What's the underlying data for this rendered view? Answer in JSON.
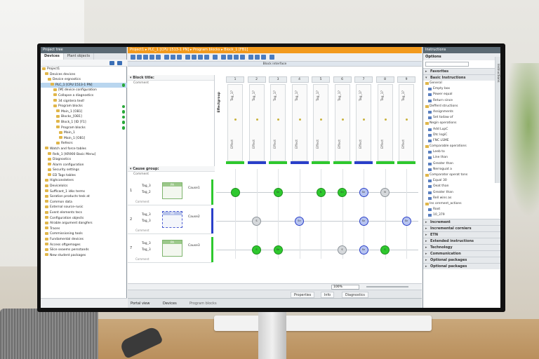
{
  "project_tree": {
    "header": "Project tree",
    "tabs": [
      "Devices",
      "Plant objects"
    ],
    "items": [
      {
        "label": "Project1",
        "ok": false,
        "sel": false
      },
      {
        "label": "Devices devices",
        "ok": false,
        "sel": false
      },
      {
        "label": "Device ergnostics",
        "ok": false,
        "sel": false
      },
      {
        "label": "PLC_1 [CPU 1513-1 PN]",
        "ok": true,
        "sel": true
      },
      {
        "label": "[M] device configuration",
        "ok": false,
        "sel": false
      },
      {
        "label": "Collapse a diagnostics",
        "ok": false,
        "sel": false
      },
      {
        "label": "34 signtera text!",
        "ok": false,
        "sel": false
      },
      {
        "label": "Program blocks",
        "ok": true,
        "sel": false
      },
      {
        "label": "Main_1 [OB1]",
        "ok": true,
        "sel": false
      },
      {
        "label": "Blocks_[OB1]",
        "ok": true,
        "sel": false
      },
      {
        "label": "Block_1 [ID [F1]",
        "ok": true,
        "sel": false
      },
      {
        "label": "Program blocks",
        "ok": true,
        "sel": false
      },
      {
        "label": "Main_1",
        "ok": false,
        "sel": false
      },
      {
        "label": "Main_1 [OB1]",
        "ok": false,
        "sel": false
      },
      {
        "label": "Refesrs",
        "ok": false,
        "sel": false
      },
      {
        "label": "Watch and force tables",
        "ok": false,
        "sel": false
      },
      {
        "label": "Relk_1 [KR900 Basic Menu]",
        "ok": false,
        "sel": false
      },
      {
        "label": "Diagnostics",
        "ok": false,
        "sel": false
      },
      {
        "label": "Alarm configuration",
        "ok": false,
        "sel": false
      },
      {
        "label": "Security settings",
        "ok": false,
        "sel": false
      },
      {
        "label": "ED Tags tables",
        "ok": false,
        "sel": false
      },
      {
        "label": "Highconsteters",
        "ok": false,
        "sel": false
      },
      {
        "label": "Devicelolcs",
        "ok": false,
        "sel": false
      },
      {
        "label": "Sufficant_1 idks terms",
        "ok": false,
        "sel": false
      },
      {
        "label": "Soration products tesk at",
        "ok": false,
        "sel": false
      },
      {
        "label": "Common data",
        "ok": false,
        "sel": false
      },
      {
        "label": "External source-rusic",
        "ok": false,
        "sel": false
      },
      {
        "label": "Event elements tecs",
        "ok": false,
        "sel": false
      },
      {
        "label": "Configuration objects",
        "ok": false,
        "sel": false
      },
      {
        "label": "Alrable argument dangfers",
        "ok": false,
        "sel": false
      },
      {
        "label": "Traces",
        "ok": false,
        "sel": false
      },
      {
        "label": "Commissioning tools",
        "ok": false,
        "sel": false
      },
      {
        "label": "Fundamental devices",
        "ok": false,
        "sel": false
      },
      {
        "label": "Access oftgemages",
        "ok": false,
        "sel": false
      },
      {
        "label": "Slice seaems persstands",
        "ok": false,
        "sel": false
      },
      {
        "label": "New student packages",
        "ok": false,
        "sel": false
      }
    ]
  },
  "editor": {
    "breadcrumb": "Project1 ▸ PLC_1 [CPU 1513-1 PN] ▸ Program blocks ▸ Block_1 [FB1]",
    "interface_header": "Block interface",
    "block_title": "Block title:",
    "block_comment": "Comment",
    "columns": [
      {
        "num": "1",
        "top": "Tag_1?",
        "bottom": "Effect",
        "bar": "#2ec82e"
      },
      {
        "num": "2",
        "top": "Tag_1?",
        "bottom": "Effect",
        "bar": "#2a3fc9"
      },
      {
        "num": "3",
        "top": "Tag_1?",
        "bottom": "Effect",
        "bar": "#2ec82e"
      },
      {
        "num": "4",
        "top": "Tag_1?",
        "bottom": "Effect",
        "bar": "#2a3fc9"
      },
      {
        "num": "5",
        "top": "Tag_1?",
        "bottom": "Effect",
        "bar": "#2ec82e"
      },
      {
        "num": "6",
        "top": "Tag_1?",
        "bottom": "Effect",
        "bar": "#2ec82e"
      },
      {
        "num": "7",
        "top": "Tag_1?",
        "bottom": "Effect",
        "bar": "#2a3fc9"
      },
      {
        "num": "8",
        "top": "Tag_1?",
        "bottom": "Effect",
        "bar": "#2ec82e"
      },
      {
        "num": "9",
        "top": "Tag_1?",
        "bottom": "Effect",
        "bar": "#2ec82e"
      }
    ],
    "effect_group_label": "Effectgroup",
    "cause_group": "Cause group:",
    "cause_comment": "Comment",
    "causes": [
      {
        "num": "1",
        "tag_a": "Tag_3",
        "tag_b": "Tag_2",
        "fb": "PA",
        "label": "Cause1",
        "comment": "Comment",
        "bar": "#2ec82e",
        "dashed": false
      },
      {
        "num": "2",
        "tag_a": "Tag_3",
        "tag_b": "Tag_3",
        "fb": "PA",
        "label": "Cause2",
        "comment": "Comment",
        "bar": "#2a3fc9",
        "dashed": true
      },
      {
        "num": "7",
        "tag_a": "Tag_3",
        "tag_b": "Tag_3",
        "fb": "PA",
        "label": "Cause3",
        "comment": "Comment",
        "bar": "#2ec82e",
        "dashed": false
      }
    ],
    "matrix": [
      {
        "row": 0,
        "col": 1,
        "kind": "g",
        "text": ""
      },
      {
        "row": 0,
        "col": 3,
        "kind": "g",
        "text": "Sn"
      },
      {
        "row": 0,
        "col": 5,
        "kind": "g",
        "text": "N"
      },
      {
        "row": 0,
        "col": 6,
        "kind": "g",
        "text": "Sn"
      },
      {
        "row": 0,
        "col": 7,
        "kind": "b",
        "text": "Sn"
      },
      {
        "row": 0,
        "col": 8,
        "kind": "gr",
        "text": "N"
      },
      {
        "row": 1,
        "col": 2,
        "kind": "gr",
        "text": "S"
      },
      {
        "row": 1,
        "col": 4,
        "kind": "b",
        "text": "Sn"
      },
      {
        "row": 1,
        "col": 7,
        "kind": "b",
        "text": "Sn"
      },
      {
        "row": 1,
        "col": 9,
        "kind": "b",
        "text": "Sn"
      },
      {
        "row": 2,
        "col": 2,
        "kind": "g",
        "text": "S"
      },
      {
        "row": 2,
        "col": 3,
        "kind": "g",
        "text": "Sn"
      },
      {
        "row": 2,
        "col": 6,
        "kind": "gr",
        "text": "S"
      },
      {
        "row": 2,
        "col": 7,
        "kind": "b",
        "text": "Sn"
      },
      {
        "row": 2,
        "col": 8,
        "kind": "g",
        "text": "S"
      }
    ],
    "zoom": "100%",
    "info_tabs": [
      "Properties",
      "Info",
      "Diagnostics"
    ]
  },
  "portal": {
    "portal_view": "Portal view",
    "devices": "Devices",
    "program_blocks": "Program blocks"
  },
  "instructions": {
    "header": "Instructions",
    "options": "Options",
    "side_tab": "Instructions",
    "panes": [
      {
        "label": "Favorites",
        "expanded": false
      },
      {
        "label": "Basic Instructions",
        "expanded": true
      }
    ],
    "basic_items": [
      {
        "label": "General",
        "grp": true
      },
      {
        "label": "Empty box",
        "grp": false
      },
      {
        "label": "Power equal",
        "grp": false
      },
      {
        "label": "Return since",
        "grp": false
      },
      {
        "label": "Defferd structions",
        "grp": true
      },
      {
        "label": "Assignments",
        "grp": false
      },
      {
        "label": "Set todaw of",
        "grp": false
      },
      {
        "label": "Negin operations",
        "grp": true
      },
      {
        "label": "Add LupC",
        "grp": false
      },
      {
        "label": "Dtc logiC",
        "grp": false
      },
      {
        "label": "FNC LSME",
        "grp": false
      },
      {
        "label": "Comparable operations",
        "grp": true
      },
      {
        "label": "Leeb to",
        "grp": false
      },
      {
        "label": "Line than",
        "grp": false
      },
      {
        "label": "Greater than",
        "grp": false
      },
      {
        "label": "Nerroguat a",
        "grp": false
      },
      {
        "label": "Comparator operat tons",
        "grp": true
      },
      {
        "label": "Equal 30",
        "grp": false
      },
      {
        "label": "Oeat than",
        "grp": false
      },
      {
        "label": "Greater than",
        "grp": false
      },
      {
        "label": "Rell wins as",
        "grp": false
      },
      {
        "label": "Ins ornment_actions",
        "grp": true
      },
      {
        "label": "Root",
        "grp": false
      },
      {
        "label": "10_379",
        "grp": false
      }
    ],
    "lower_panes": [
      "Increment",
      "Incremental corniers",
      "ETN",
      "Extended instructions",
      "Technology",
      "Communication",
      "Optional packages",
      "Optional packages"
    ]
  }
}
